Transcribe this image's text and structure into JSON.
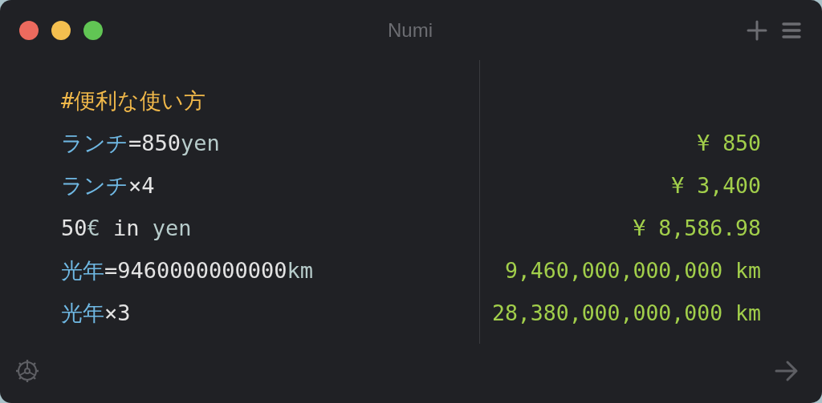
{
  "window": {
    "title": "Numi"
  },
  "lines": [
    {
      "tokens": [
        {
          "kind": "comment",
          "text": "#便利な使い方"
        }
      ]
    },
    {
      "tokens": [
        {
          "kind": "variable",
          "text": "ランチ"
        },
        {
          "kind": "plain",
          "text": "=850"
        },
        {
          "kind": "unit",
          "text": "yen"
        }
      ],
      "result": "¥ 850"
    },
    {
      "tokens": [
        {
          "kind": "variable",
          "text": "ランチ"
        },
        {
          "kind": "plain",
          "text": "×4"
        }
      ],
      "result": "¥ 3,400"
    },
    {
      "tokens": [
        {
          "kind": "plain",
          "text": "50"
        },
        {
          "kind": "unit",
          "text": "€"
        },
        {
          "kind": "plain",
          "text": " in "
        },
        {
          "kind": "unit",
          "text": "yen"
        }
      ],
      "result": "¥ 8,586.98"
    },
    {
      "tokens": [
        {
          "kind": "variable",
          "text": "光年"
        },
        {
          "kind": "plain",
          "text": "=9460000000000"
        },
        {
          "kind": "unit",
          "text": "km"
        }
      ],
      "result": "9,460,000,000,000 km"
    },
    {
      "tokens": [
        {
          "kind": "variable",
          "text": "光年"
        },
        {
          "kind": "plain",
          "text": "×3"
        }
      ],
      "result": "28,380,000,000,000 km"
    }
  ]
}
